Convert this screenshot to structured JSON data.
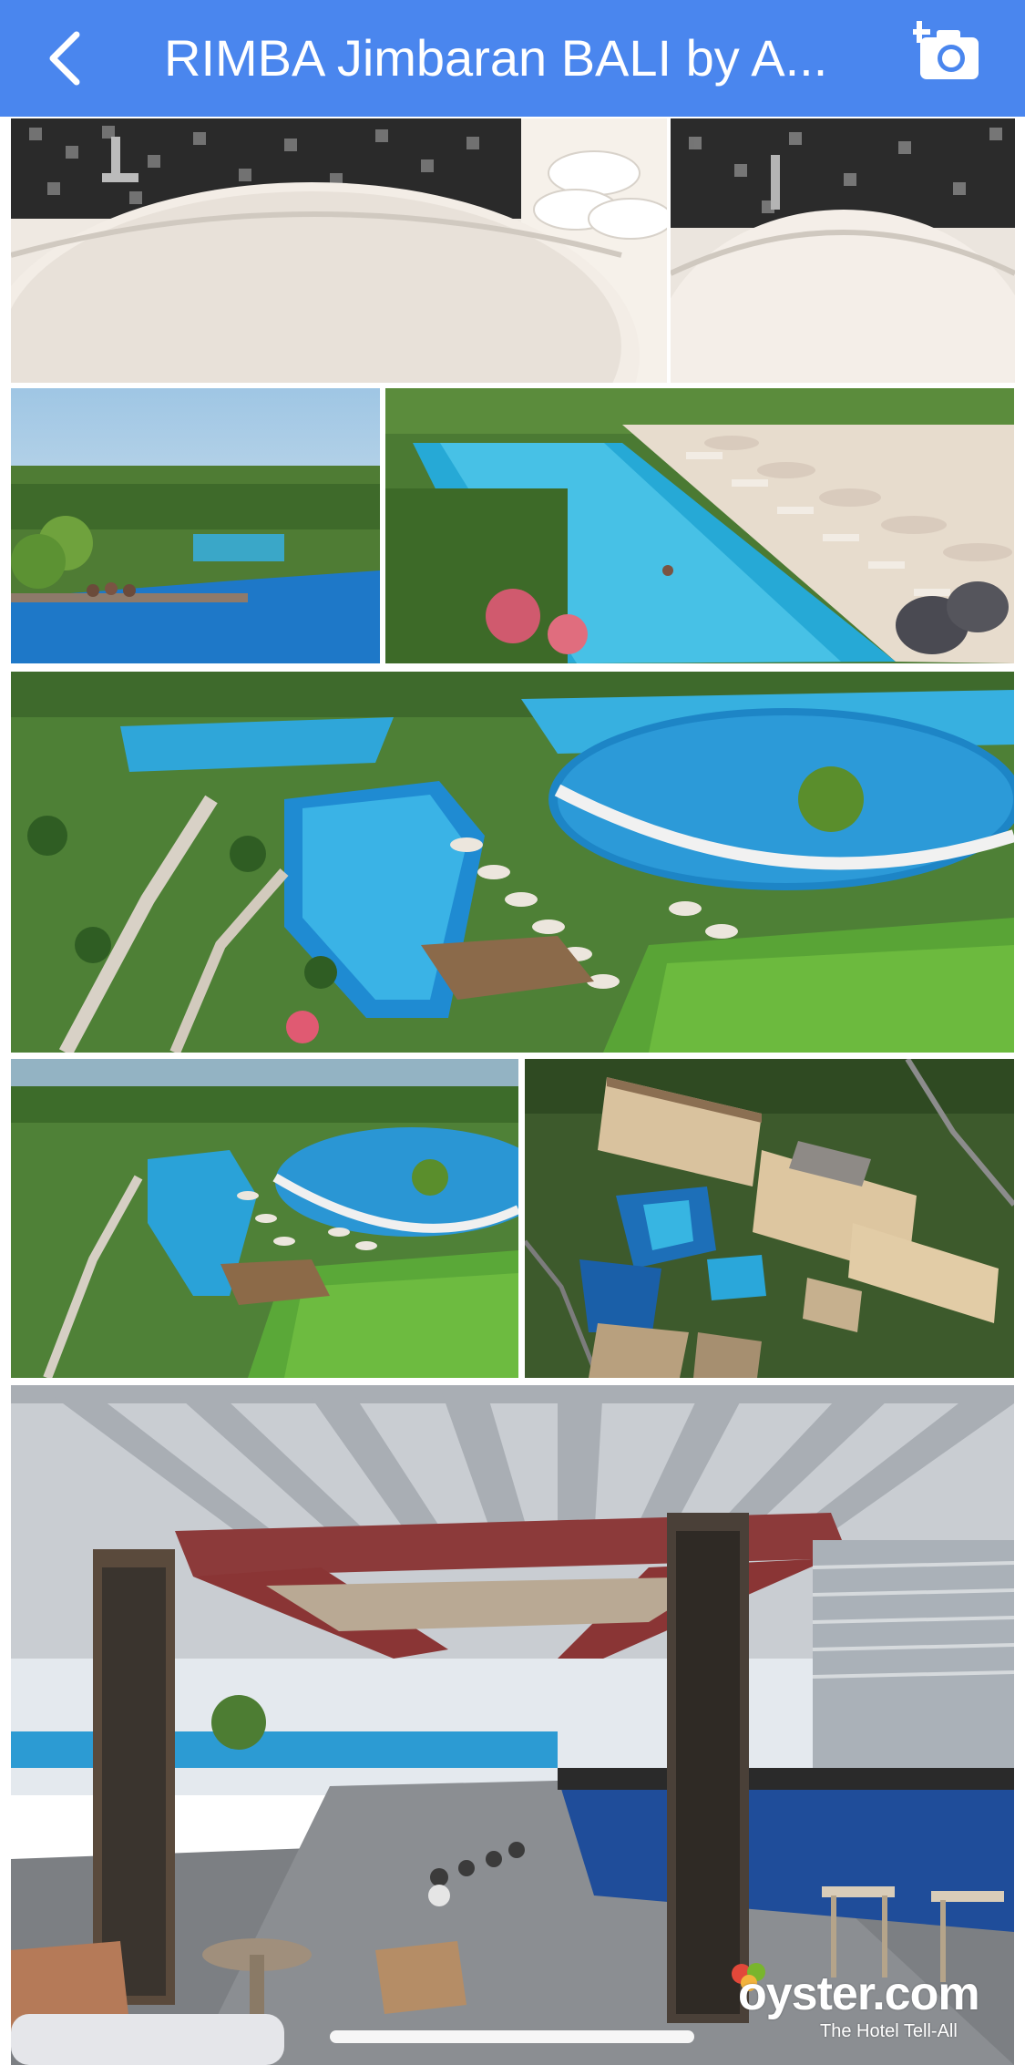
{
  "navbar": {
    "title": "RIMBA Jimbaran BALI by A...",
    "background": "#4a86ee",
    "back_icon": "chevron-left-icon",
    "camera_icon": "add-photo-camera-icon"
  },
  "photos": [
    {
      "subject": "bathtub-mosaic-towels"
    },
    {
      "subject": "bathtub-closeup"
    },
    {
      "subject": "infinity-pool-jungle-view"
    },
    {
      "subject": "long-pool-sunbeds"
    },
    {
      "subject": "aerial-pool-terraces"
    },
    {
      "subject": "pool-terraces-gardens"
    },
    {
      "subject": "aerial-resort-buildings"
    },
    {
      "subject": "rooftop-bar-lounge"
    }
  ],
  "watermark": {
    "logo_text": "oyster.com",
    "tagline": "The Hotel Tell-All"
  }
}
